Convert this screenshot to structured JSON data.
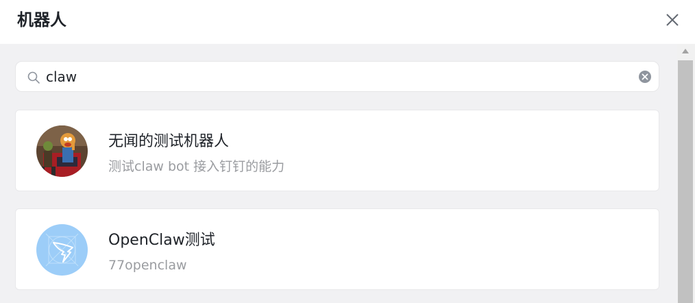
{
  "dialog": {
    "title": "机器人",
    "close_icon": "close-icon"
  },
  "search": {
    "value": "claw",
    "search_icon": "search-icon",
    "clear_icon": "clear-circle-icon"
  },
  "results": [
    {
      "name": "无闻的测试机器人",
      "description": "测试claw bot 接入钉钉的能力",
      "avatar": "photo-avatar"
    },
    {
      "name": "OpenClaw测试",
      "description": "77openclaw",
      "avatar": "dingtalk-logo-avatar"
    }
  ],
  "colors": {
    "avatar_blue": "#9ccdf8",
    "panel_bg": "#f1f1f3",
    "secondary_text": "#9a9ca0"
  }
}
